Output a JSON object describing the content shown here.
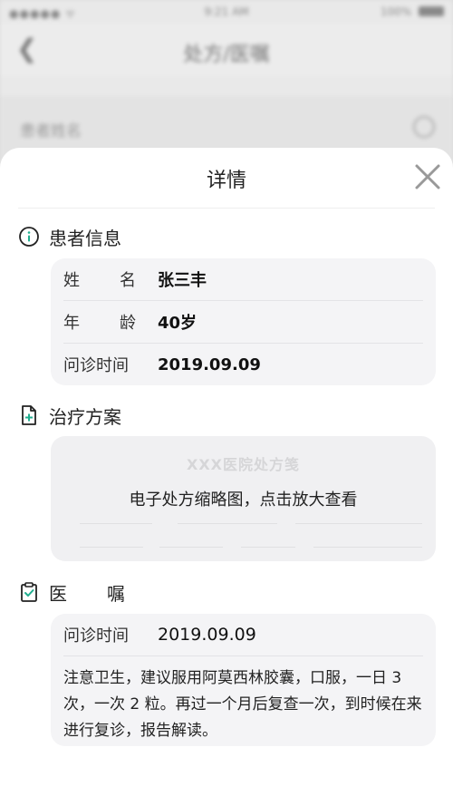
{
  "status_bar": {
    "signal": "●●●●● ᯤ",
    "time": "9:21 AM",
    "battery": "100%"
  },
  "nav": {
    "back_icon": "chevron-left-icon",
    "title": "处方/医嘱"
  },
  "search": {
    "placeholder": "患者姓名"
  },
  "sheet": {
    "title": "详情",
    "close_icon": "close-icon"
  },
  "patient": {
    "section_title": "患者信息",
    "name_label_1": "姓",
    "name_label_2": "名",
    "name_value": "张三丰",
    "age_label_1": "年",
    "age_label_2": "龄",
    "age_value": "40岁",
    "visit_label": "问诊时间",
    "visit_value": "2019.09.09"
  },
  "treatment": {
    "section_title": "治疗方案",
    "thumb_bg_title": "XXX医院处方笺",
    "thumb_caption": "电子处方缩略图，点击放大查看"
  },
  "advice": {
    "section_title_1": "医",
    "section_title_2": "嘱",
    "visit_label": "问诊时间",
    "visit_value": "2019.09.09",
    "text": "注意卫生，建议服用阿莫西林胶囊，口服，一日 3 次，一次 2 粒。再过一个月后复查一次，到时候在来进行复诊，报告解读。"
  },
  "colors": {
    "accent": "#1fae8f",
    "card_bg": "#f4f4f6"
  }
}
